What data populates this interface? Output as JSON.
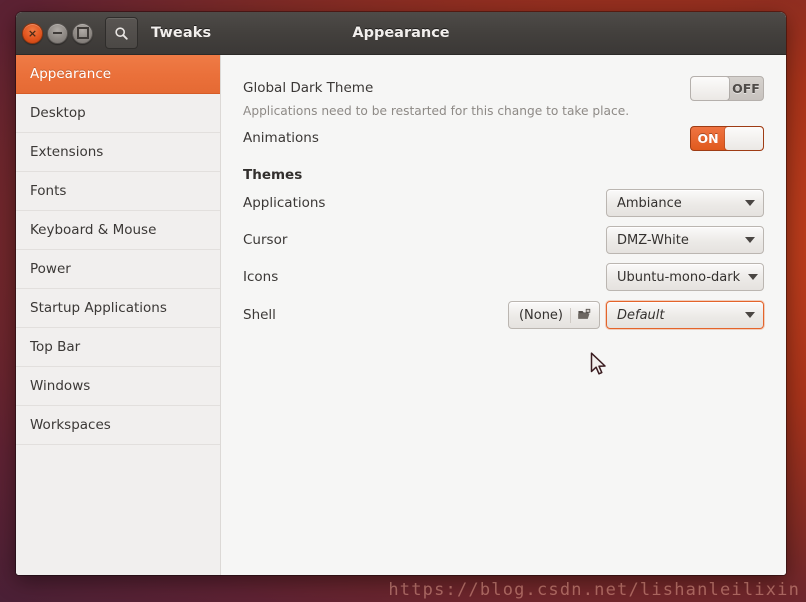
{
  "titlebar": {
    "app_name": "Tweaks",
    "window_title": "Appearance",
    "search_icon": "search-icon",
    "close_glyph": "×",
    "close_label": "Close",
    "minimize_label": "Minimize",
    "maximize_label": "Maximize"
  },
  "sidebar": {
    "items": [
      {
        "label": "Appearance",
        "selected": true
      },
      {
        "label": "Desktop",
        "selected": false
      },
      {
        "label": "Extensions",
        "selected": false
      },
      {
        "label": "Fonts",
        "selected": false
      },
      {
        "label": "Keyboard & Mouse",
        "selected": false
      },
      {
        "label": "Power",
        "selected": false
      },
      {
        "label": "Startup Applications",
        "selected": false
      },
      {
        "label": "Top Bar",
        "selected": false
      },
      {
        "label": "Windows",
        "selected": false
      },
      {
        "label": "Workspaces",
        "selected": false
      }
    ]
  },
  "content": {
    "global_dark_theme": {
      "label": "Global Dark Theme",
      "description": "Applications need to be restarted for this change to take place.",
      "toggle_state": "OFF"
    },
    "animations": {
      "label": "Animations",
      "toggle_state": "ON"
    },
    "themes_heading": "Themes",
    "theme_rows": [
      {
        "label": "Applications",
        "value": "Ambiance"
      },
      {
        "label": "Cursor",
        "value": "DMZ-White"
      },
      {
        "label": "Icons",
        "value": "Ubuntu-mono-dark"
      }
    ],
    "shell_row": {
      "label": "Shell",
      "file_button_value": "(None)",
      "file_button_icon": "folder-open-icon",
      "value": "Default"
    }
  },
  "watermark": "https://blog.csdn.net/lishanleilixin",
  "colors": {
    "accent_orange": "#e56a34",
    "toggle_on": "#e05a1e",
    "titlebar": "#43403d",
    "sidebar_bg": "#f1efee",
    "content_bg": "#f6f6f5"
  }
}
